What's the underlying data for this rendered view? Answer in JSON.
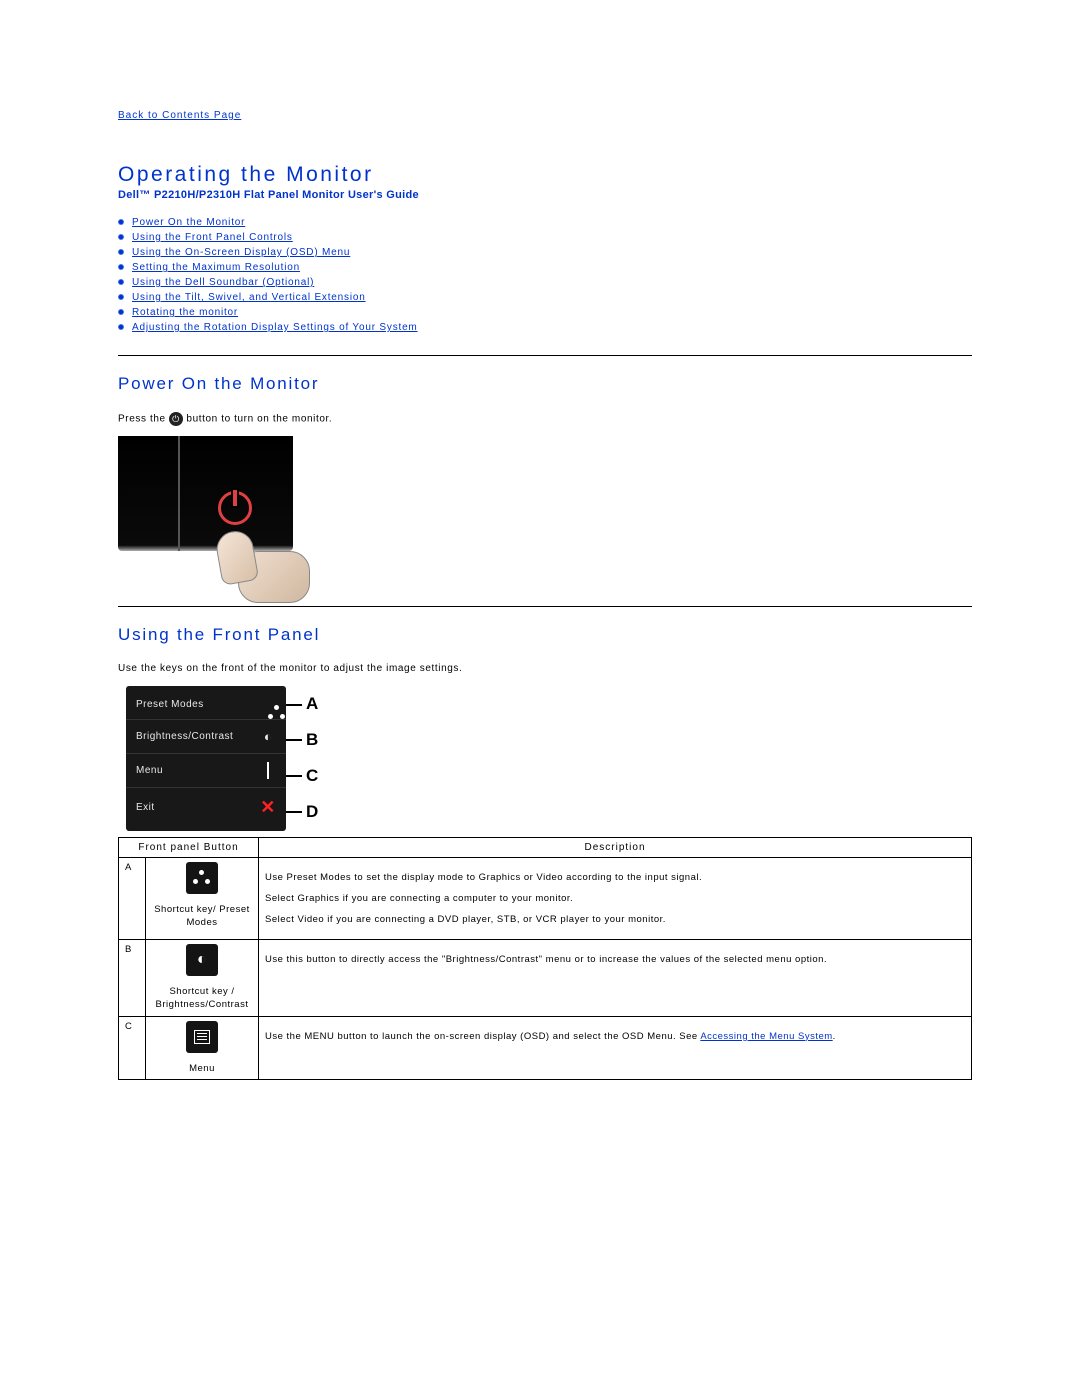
{
  "back_link": "Back to Contents Page",
  "main_title": "Operating the Monitor",
  "subtitle": "Dell™ P2210H/P2310H Flat Panel Monitor User's Guide",
  "toc": [
    "Power On the Monitor",
    "Using the Front Panel Controls",
    "Using the On-Screen Display (OSD) Menu",
    "Setting the Maximum Resolution",
    "Using the Dell Soundbar (Optional)",
    "Using the Tilt, Swivel, and Vertical Extension",
    "Rotating the monitor",
    "Adjusting the Rotation Display Settings of Your System"
  ],
  "section_power": {
    "heading": "Power On the Monitor",
    "text_before": "Press the ",
    "text_after": " button to turn on the monitor."
  },
  "section_front": {
    "heading": "Using the Front Panel",
    "intro": "Use the keys on the front of the monitor to adjust the image settings.",
    "osd_rows": [
      {
        "label": "Preset Modes",
        "letter": "A",
        "icon": "dots"
      },
      {
        "label": "Brightness/Contrast",
        "letter": "B",
        "icon": "bright"
      },
      {
        "label": "Menu",
        "letter": "C",
        "icon": "menu"
      },
      {
        "label": "Exit",
        "letter": "D",
        "icon": "x"
      }
    ],
    "table": {
      "header1": "Front panel Button",
      "header2": "Description",
      "rows": [
        {
          "letter": "A",
          "icon": "dots",
          "caption": "Shortcut key/ Preset Modes",
          "desc": [
            "Use Preset Modes to set the display mode to Graphics or Video according to the input signal.",
            "Select Graphics if you are connecting a computer to your monitor.",
            "Select Video if you are connecting a DVD player, STB, or VCR player to your monitor."
          ]
        },
        {
          "letter": "B",
          "icon": "bright",
          "caption": "Shortcut key / Brightness/Contrast",
          "desc": [
            "Use this button to directly access the \"Brightness/Contrast\" menu or to increase the values of the selected menu option."
          ]
        },
        {
          "letter": "C",
          "icon": "menu",
          "caption": "Menu",
          "desc_before": "Use the MENU button to launch the on-screen display (OSD) and select the OSD Menu. See ",
          "desc_link": "Accessing the Menu System",
          "desc_after": "."
        }
      ]
    }
  }
}
